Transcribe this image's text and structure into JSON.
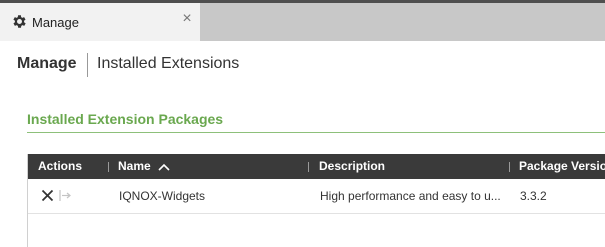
{
  "tab": {
    "icon": "gear-icon",
    "label": "Manage",
    "close_icon": "close-icon",
    "close_glyph": "×"
  },
  "header": {
    "title": "Manage",
    "breadcrumb": "Installed Extensions"
  },
  "section": {
    "title": "Installed Extension Packages",
    "accent_color": "#6aa84f"
  },
  "table": {
    "columns": [
      {
        "label": "Actions"
      },
      {
        "label": "Name",
        "sort": "ascending",
        "sort_icon": "sort-ascending-icon"
      },
      {
        "label": "Description"
      },
      {
        "label": "Package Version"
      }
    ],
    "rows": [
      {
        "actions": [
          "remove-icon",
          "export-icon"
        ],
        "name": "IQNOX-Widgets",
        "description": "High performance and easy to u...",
        "version": "3.3.2"
      }
    ],
    "header_bg": "#3a3a3a"
  }
}
